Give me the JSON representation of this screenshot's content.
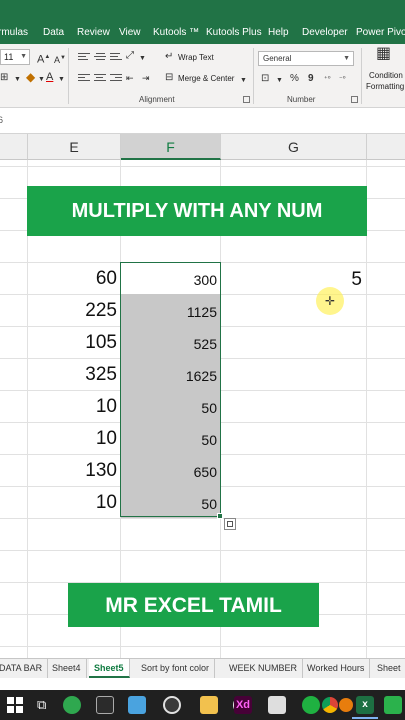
{
  "ribbon_tabs": [
    "rmulas",
    "Data",
    "Review",
    "View",
    "Kutools ™",
    "Kutools Plus",
    "Help",
    "Developer",
    "Power Pivot"
  ],
  "ribbon": {
    "font_size": "11",
    "wrap_text": "Wrap Text",
    "merge_center": "Merge & Center",
    "alignment_label": "Alignment",
    "number_format": "General",
    "percent": "%",
    "comma": "9",
    "number_label": "Number",
    "conditional_line1": "Condition",
    "conditional_line2": "Formatting"
  },
  "formula_bar": {
    "cell_ref": "6"
  },
  "columns": {
    "e": "E",
    "f": "F",
    "g": "G"
  },
  "title_banner": "MULTIPLY WITH ANY NUM",
  "footer_banner": "MR EXCEL TAMIL",
  "rows": [
    {
      "e": "60",
      "f": "300"
    },
    {
      "e": "225",
      "f": "1125"
    },
    {
      "e": "105",
      "f": "525"
    },
    {
      "e": "325",
      "f": "1625"
    },
    {
      "e": "10",
      "f": "50"
    },
    {
      "e": "10",
      "f": "50"
    },
    {
      "e": "130",
      "f": "650"
    },
    {
      "e": "10",
      "f": "50"
    }
  ],
  "multiplier": "5",
  "sheet_tabs": [
    {
      "label": "DATA BAR",
      "active": false
    },
    {
      "label": "Sheet4",
      "active": false
    },
    {
      "label": "Sheet5",
      "active": true
    },
    {
      "label": "Sort by font color",
      "active": false
    },
    {
      "label": "WEEK NUMBER",
      "active": false
    },
    {
      "label": "Worked Hours",
      "active": false
    },
    {
      "label": "Sheet",
      "active": false
    }
  ],
  "colors": {
    "excel_green": "#217346",
    "banner_green": "#1aa34a",
    "selection_fill": "#c8c8c8",
    "cursor_highlight": "#fff050"
  },
  "taskbar_icons": [
    "start-icon",
    "task-view-icon",
    "torrent-icon",
    "clapper-icon",
    "image-viewer-icon",
    "media-player-icon",
    "folder-icon",
    "browser-icon",
    "adobe-xd-icon",
    "calendar-icon",
    "pen-tool-icon",
    "chrome-icon",
    "blender-icon",
    "excel-icon",
    "chat-icon"
  ]
}
